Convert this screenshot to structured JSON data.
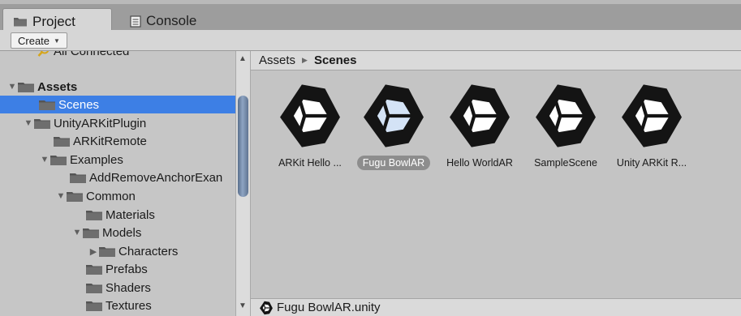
{
  "tabs": {
    "project": {
      "label": "Project",
      "icon": "folder-icon"
    },
    "console": {
      "label": "Console",
      "icon": "console-icon"
    }
  },
  "toolbar": {
    "create_label": "Create"
  },
  "tree": {
    "items": [
      {
        "label": "All Connected",
        "icon": "search-icon",
        "bold": false,
        "arrow": ""
      },
      {
        "label": "Assets",
        "bold": true,
        "arrow": "expanded"
      },
      {
        "label": "Scenes",
        "bold": false,
        "arrow": "",
        "selected": true
      },
      {
        "label": "UnityARKitPlugin",
        "bold": false,
        "arrow": "expanded"
      },
      {
        "label": "ARKitRemote",
        "bold": false,
        "arrow": ""
      },
      {
        "label": "Examples",
        "bold": false,
        "arrow": "expanded"
      },
      {
        "label": "AddRemoveAnchorExan",
        "bold": false,
        "arrow": ""
      },
      {
        "label": "Common",
        "bold": false,
        "arrow": "expanded"
      },
      {
        "label": "Materials",
        "bold": false,
        "arrow": ""
      },
      {
        "label": "Models",
        "bold": false,
        "arrow": "expanded"
      },
      {
        "label": "Characters",
        "bold": false,
        "arrow": "collapsed"
      },
      {
        "label": "Prefabs",
        "bold": false,
        "arrow": ""
      },
      {
        "label": "Shaders",
        "bold": false,
        "arrow": ""
      },
      {
        "label": "Textures",
        "bold": false,
        "arrow": ""
      }
    ]
  },
  "breadcrumb": {
    "root": "Assets",
    "current": "Scenes"
  },
  "assets": [
    {
      "label": "ARKit Hello ...",
      "icon": "unity-scene-icon",
      "selected": false
    },
    {
      "label": "Fugu BowlAR",
      "icon": "unity-scene-icon",
      "selected": true
    },
    {
      "label": "Hello WorldAR",
      "icon": "unity-scene-icon",
      "selected": false
    },
    {
      "label": "SampleScene",
      "icon": "unity-scene-icon",
      "selected": false
    },
    {
      "label": "Unity ARKit R...",
      "icon": "unity-scene-icon",
      "selected": false
    }
  ],
  "status": {
    "selected_file": "Fugu BowlAR.unity"
  },
  "colors": {
    "selection": "#3d7fe5",
    "selected_icon_tint": "#d4e3f6"
  }
}
